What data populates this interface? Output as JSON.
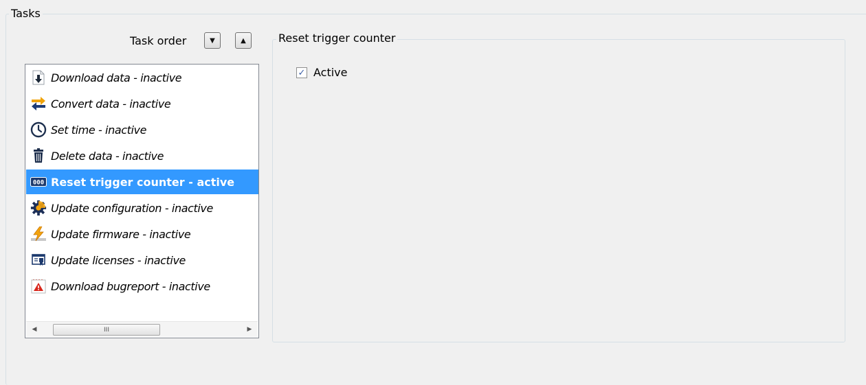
{
  "tasks_group": {
    "title": "Tasks"
  },
  "task_order": {
    "label": "Task order",
    "down_icon": "triangle-down-icon",
    "up_icon": "triangle-up-icon"
  },
  "task_list": {
    "items": [
      {
        "label": "Download data - inactive",
        "icon": "download-arrow-icon",
        "selected": false
      },
      {
        "label": "Convert data - inactive",
        "icon": "convert-arrows-icon",
        "selected": false
      },
      {
        "label": "Set time - inactive",
        "icon": "clock-icon",
        "selected": false
      },
      {
        "label": "Delete data - inactive",
        "icon": "trash-icon",
        "selected": false
      },
      {
        "label": "Reset trigger counter - active",
        "icon": "counter-icon",
        "selected": true
      },
      {
        "label": "Update configuration - inactive",
        "icon": "gear-icon",
        "selected": false
      },
      {
        "label": "Update firmware - inactive",
        "icon": "firmware-bolt-icon",
        "selected": false
      },
      {
        "label": "Update licenses - inactive",
        "icon": "license-certificate-icon",
        "selected": false
      },
      {
        "label": "Download bugreport - inactive",
        "icon": "bugreport-warning-icon",
        "selected": false
      }
    ],
    "scroll_thumb_grip": "III"
  },
  "reset_group": {
    "title": "Reset trigger counter",
    "active_checkbox": {
      "label": "Active",
      "checked": true,
      "mark": "✓"
    }
  },
  "colors": {
    "selection": "#3399ff",
    "window_bg": "#f0f0f0"
  }
}
